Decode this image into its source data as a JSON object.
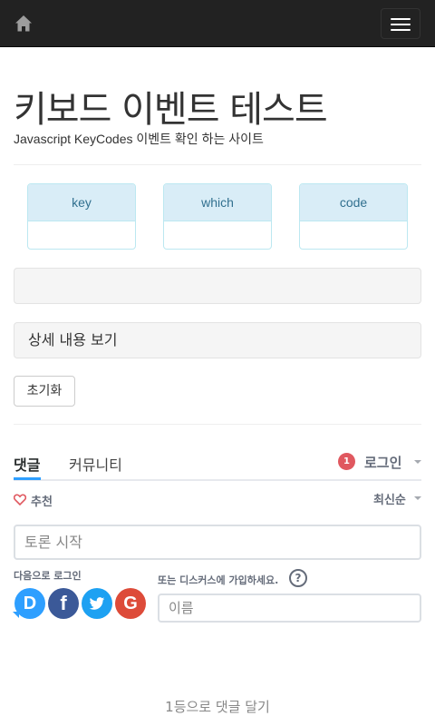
{
  "navbar": {
    "home_icon": "home-icon",
    "menu_icon": "hamburger-icon"
  },
  "header": {
    "title": "키보드 이벤트 테스트",
    "subtitle": "Javascript KeyCodes 이벤트 확인 하는 사이트"
  },
  "key_panels": [
    {
      "label": "key",
      "value": ""
    },
    {
      "label": "which",
      "value": ""
    },
    {
      "label": "code",
      "value": ""
    }
  ],
  "result": {
    "text": ""
  },
  "detail": {
    "label": "상세 내용 보기"
  },
  "reset": {
    "label": "초기화"
  },
  "comments": {
    "tabs": [
      {
        "label": "댓글",
        "active": true
      },
      {
        "label": "커뮤니티",
        "active": false
      }
    ],
    "notification_count": "1",
    "login_label": "로그인",
    "recommend_label": "추천",
    "sort_label": "최신순",
    "input_placeholder": "토론 시작",
    "login_with_label": "다음으로 로그인",
    "or_signup_label": "또는 디스커스에 가입하세요.",
    "help_glyph": "?",
    "name_placeholder": "이름",
    "first_comment_label": "1등으로 댓글 달기",
    "social_logins": [
      {
        "name": "disqus",
        "glyph": "D",
        "color": "#2e9fff"
      },
      {
        "name": "facebook",
        "glyph": "f",
        "color": "#3b5998"
      },
      {
        "name": "twitter",
        "glyph": "",
        "color": "#1da1f2"
      },
      {
        "name": "google",
        "glyph": "G",
        "color": "#dd4b39"
      }
    ],
    "accent_color": "#2e9fff",
    "badge_color": "#e0585f"
  }
}
